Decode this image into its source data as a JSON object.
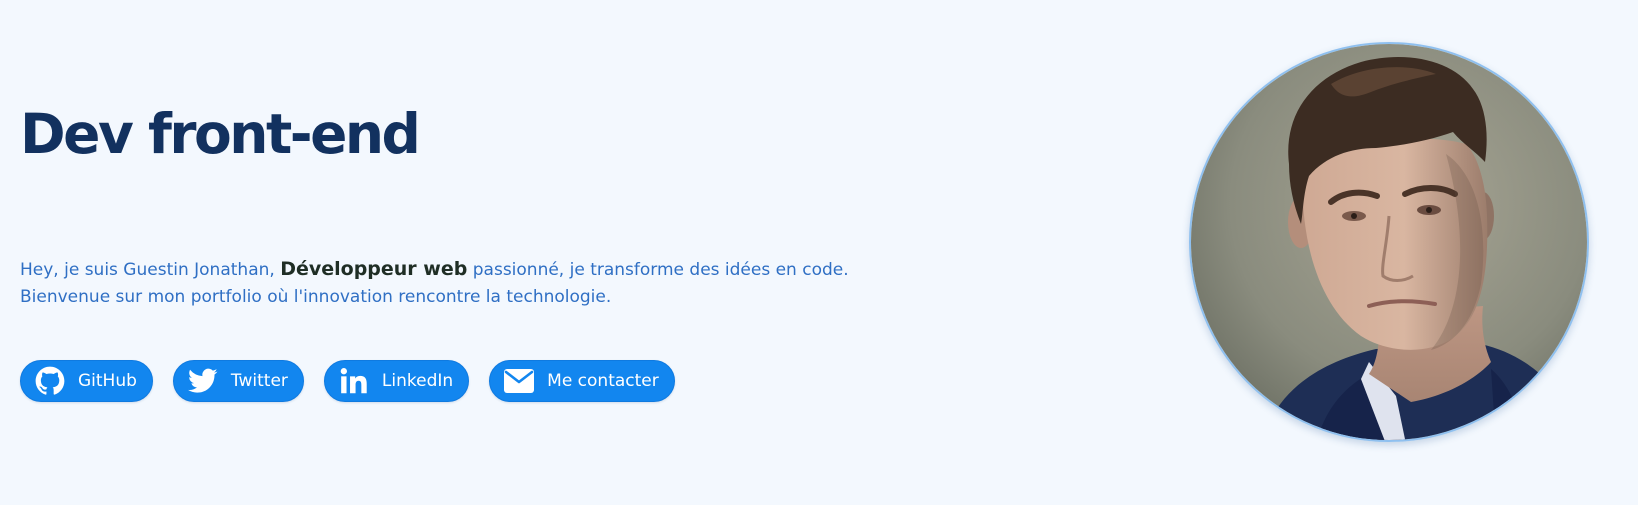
{
  "hero": {
    "title": "Dev front-end",
    "intro_before": "Hey, je suis Guestin Jonathan, ",
    "intro_highlight": "Développeur web",
    "intro_after": " passionné, je transforme des idées en code.",
    "intro_line2": "Bienvenue sur mon portfolio où l'innovation rencontre la technologie."
  },
  "social": {
    "buttons": [
      {
        "label": "GitHub",
        "icon": "github-icon"
      },
      {
        "label": "Twitter",
        "icon": "twitter-icon"
      },
      {
        "label": "LinkedIn",
        "icon": "linkedin-icon"
      },
      {
        "label": "Me contacter",
        "icon": "mail-icon"
      }
    ]
  },
  "avatar": {
    "alt": "portrait photo"
  },
  "colors": {
    "background": "#f3f8fe",
    "title": "#12315f",
    "text": "#2f6fc4",
    "button": "#1286ef"
  }
}
